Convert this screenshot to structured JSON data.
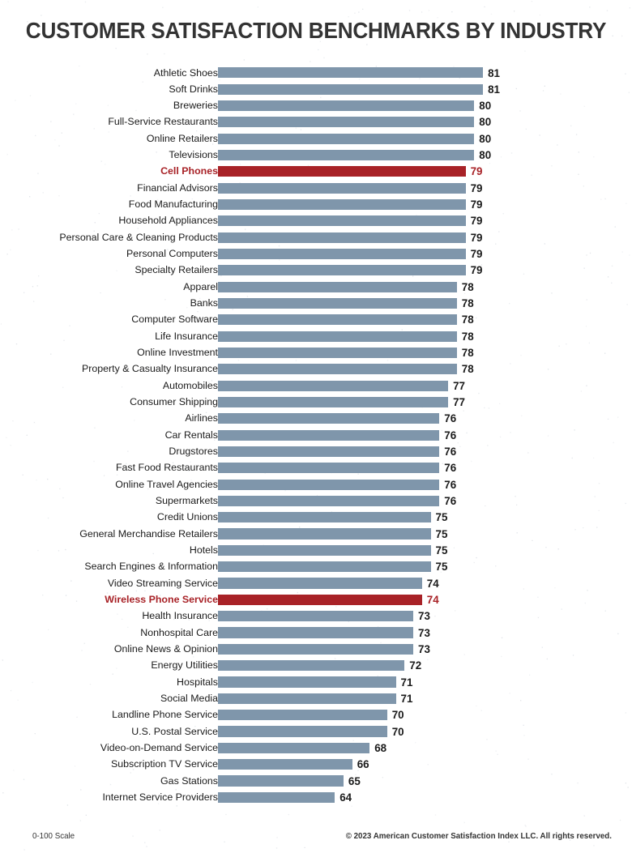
{
  "title": "CUSTOMER SATISFACTION BENCHMARKS BY INDUSTRY",
  "footer": {
    "scale_note": "0-100 Scale",
    "copyright": "© 2023 American Customer Satisfaction Index LLC. All rights reserved."
  },
  "colors": {
    "bar_default": "#7f96ab",
    "bar_highlight": "#a82227",
    "label_default": "#1b1b1b",
    "label_highlight": "#a82227",
    "title": "#333333",
    "background": "#ffffff"
  },
  "chart_data": {
    "type": "bar",
    "orientation": "horizontal",
    "title": "CUSTOMER SATISFACTION BENCHMARKS BY INDUSTRY",
    "xlabel": "",
    "ylabel": "",
    "scale": "0-100 Scale",
    "grid": false,
    "legend": "none",
    "value_labels": true,
    "sorted": "descending",
    "bar_axis_start": 50.6,
    "bar_axis_end": 84,
    "highlighted_categories": [
      "Cell Phones",
      "Wireless Phone Service"
    ],
    "categories": [
      "Athletic Shoes",
      "Soft Drinks",
      "Breweries",
      "Full-Service Restaurants",
      "Online Retailers",
      "Televisions",
      "Cell Phones",
      "Financial Advisors",
      "Food Manufacturing",
      "Household Appliances",
      "Personal Care & Cleaning Products",
      "Personal Computers",
      "Specialty Retailers",
      "Apparel",
      "Banks",
      "Computer Software",
      "Life Insurance",
      "Online Investment",
      "Property & Casualty Insurance",
      "Automobiles",
      "Consumer Shipping",
      "Airlines",
      "Car Rentals",
      "Drugstores",
      "Fast Food Restaurants",
      "Online Travel Agencies",
      "Supermarkets",
      "Credit Unions",
      "General Merchandise Retailers",
      "Hotels",
      "Search Engines & Information",
      "Video Streaming Service",
      "Wireless Phone Service",
      "Health Insurance",
      "Nonhospital Care",
      "Online News & Opinion",
      "Energy Utilities",
      "Hospitals",
      "Social Media",
      "Landline Phone Service",
      "U.S. Postal Service",
      "Video-on-Demand Service",
      "Subscription TV Service",
      "Gas Stations",
      "Internet Service Providers"
    ],
    "values": [
      81,
      81,
      80,
      80,
      80,
      80,
      79,
      79,
      79,
      79,
      79,
      79,
      79,
      78,
      78,
      78,
      78,
      78,
      78,
      77,
      77,
      76,
      76,
      76,
      76,
      76,
      76,
      75,
      75,
      75,
      75,
      74,
      74,
      73,
      73,
      73,
      72,
      71,
      71,
      70,
      70,
      68,
      66,
      65,
      64
    ]
  }
}
